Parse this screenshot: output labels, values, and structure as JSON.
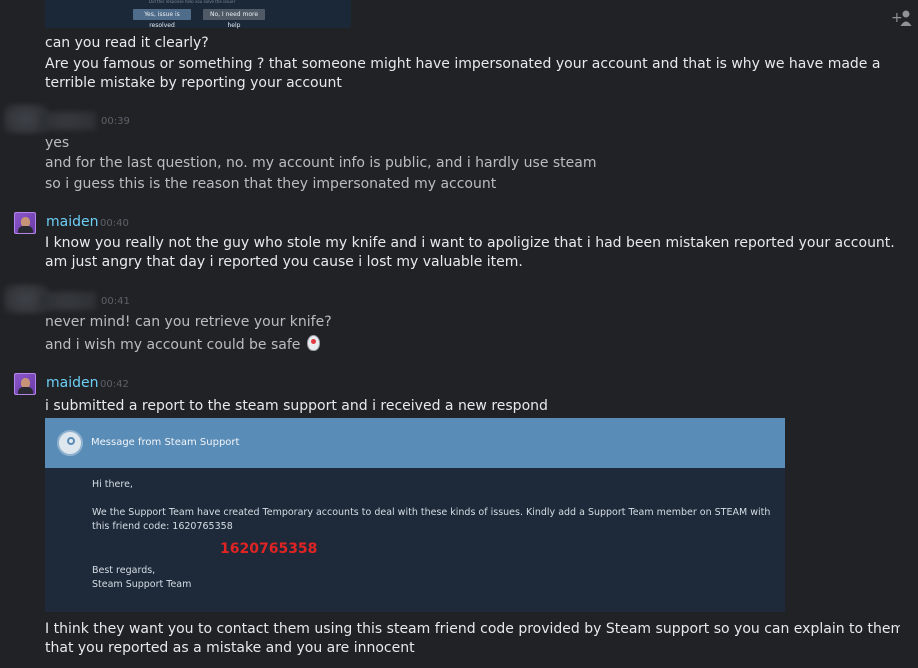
{
  "top_screenshot": {
    "question": "Did this response help you solve the issue?",
    "yes_button": "Yes, issue is resolved",
    "no_button": "No, I need more help"
  },
  "messages": [
    {
      "lines": [
        "can you read it clearly?",
        "Are you famous or something ? that someone might have impersonated your account and that is why we have made a terrible mistake by reporting your account"
      ]
    },
    {
      "time": "00:39",
      "lines": [
        "yes",
        "and for the last question, no. my account info is public, and i hardly use steam",
        "so i guess this is the reason that they impersonated my account"
      ]
    },
    {
      "sender": "maiden",
      "time": "00:40",
      "lines": [
        "I know you really not the guy who stole my knife and i want to apoligize that i had been mistaken reported your account. I am just angry that day i reported you cause i lost my valuable item."
      ]
    },
    {
      "time": "00:41",
      "lines": [
        "never mind! can you retrieve your knife?",
        "and i wish my account could be safe"
      ]
    },
    {
      "sender": "maiden",
      "time": "00:42",
      "lines": [
        "i submitted a report to the steam support and i received a new respond",
        "I think they want you to contact them using this steam friend code provided by Steam support so you can explain to them that you reported as a mistake and you are innocent"
      ]
    }
  ],
  "support_card": {
    "title": "Message from Steam Support",
    "greeting": "Hi there,",
    "body": "We the Support Team have created Temporary accounts to deal with these kinds of issues. Kindly add a Support Team member on STEAM with this friend code: 1620765358",
    "highlight_code": "1620765358",
    "signoff_1": "Best regards,",
    "signoff_2": "Steam Support Team"
  },
  "icons": {
    "corner": "add-friend-icon",
    "emoticon": "steam-emoticon-icon"
  },
  "colors": {
    "background": "#202226",
    "sender_name": "#6dcff6",
    "card_header": "#5a8cb8",
    "code_red": "#e02424"
  }
}
